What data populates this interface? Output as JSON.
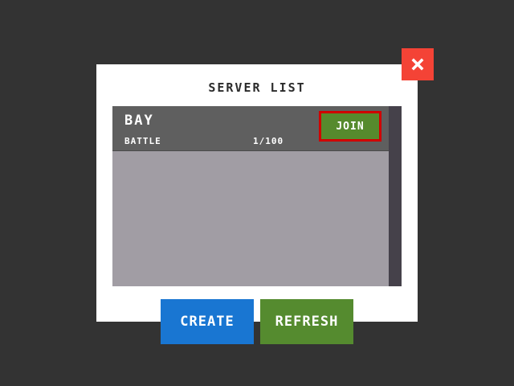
{
  "dialog": {
    "title": "SERVER LIST",
    "close_icon": "close-icon"
  },
  "servers": [
    {
      "name": "BAY",
      "mode": "BATTLE",
      "players": "1/100",
      "join_label": "JOIN"
    }
  ],
  "buttons": {
    "create_label": "CREATE",
    "refresh_label": "REFRESH"
  },
  "colors": {
    "background": "#333333",
    "dialog": "#ffffff",
    "close": "#f44336",
    "list_panel": "#a19da4",
    "row": "#5f5f5f",
    "scrollbar": "#45414a",
    "join": "#568a2d",
    "join_border": "#d00000",
    "create": "#1976d2",
    "refresh": "#558b2f"
  }
}
